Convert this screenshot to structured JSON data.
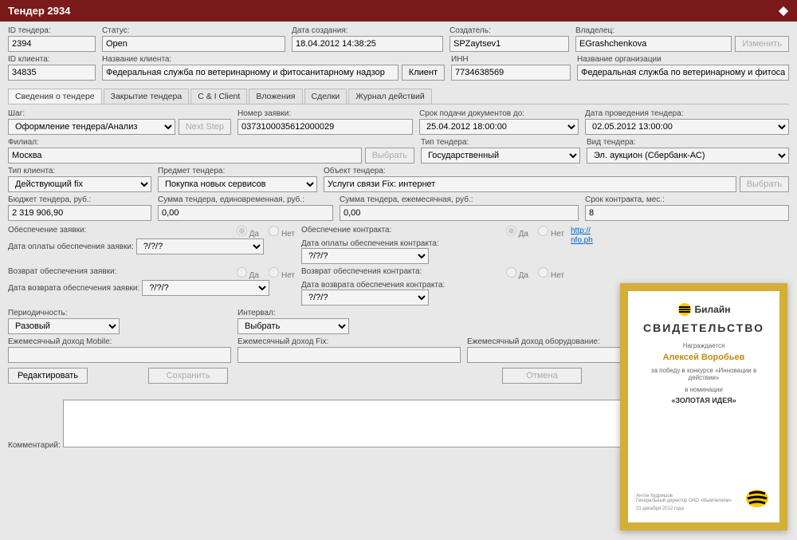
{
  "title": "Тендер 2934",
  "header": {
    "id_tender": {
      "label": "ID тендера:",
      "value": "2394"
    },
    "status": {
      "label": "Статус:",
      "value": "Open"
    },
    "created": {
      "label": "Дата создания:",
      "value": "18.04.2012 14:38:25"
    },
    "creator": {
      "label": "Создатель:",
      "value": "SPZaytsev1"
    },
    "owner": {
      "label": "Владелец:",
      "value": "EGrashchenkova",
      "change_btn": "Изменить"
    },
    "id_client": {
      "label": "ID клиента:",
      "value": "34835"
    },
    "client_name": {
      "label": "Название клиента:",
      "value": "Федеральная служба по ветеринарному и фитосанитарному надзор",
      "btn": "Клиент"
    },
    "inn": {
      "label": "ИНН",
      "value": "7734638569"
    },
    "org_name": {
      "label": "Название организации",
      "value": "Федеральная служба по ветеринарному и фитосан"
    }
  },
  "tabs": [
    "Сведения о тендере",
    "Закрытие тендера",
    "C & I Client",
    "Вложения",
    "Сделки",
    "Журнал действий"
  ],
  "form": {
    "step": {
      "label": "Шаг:",
      "value": "Оформление тендера/Анализ",
      "next_btn": "Next Step"
    },
    "app_num": {
      "label": "Номер заявки:",
      "value": "0373100035612000029"
    },
    "doc_deadline": {
      "label": "Срок подачи документов до:",
      "value": "25.04.2012 18:00:00"
    },
    "tender_date": {
      "label": "Дата проведения тендера:",
      "value": "02.05.2012 13:00:00"
    },
    "branch": {
      "label": "Филиал:",
      "value": "Москва",
      "btn": "Выбрать"
    },
    "tender_type": {
      "label": "Тип тендера:",
      "value": "Государственный"
    },
    "tender_kind": {
      "label": "Вид тендера:",
      "value": "Эл. аукцион (Сбербанк-АС)"
    },
    "client_type": {
      "label": "Тип клиента:",
      "value": "Действующий fix"
    },
    "subject": {
      "label": "Предмет тендера:",
      "value": "Покупка новых сервисов"
    },
    "object": {
      "label": "Объект тендера:",
      "value": "Услуги связи Fix: интернет",
      "btn": "Выбрать"
    },
    "budget": {
      "label": "Бюджет тендера, руб.:",
      "value": "2 319 906,90"
    },
    "sum_once": {
      "label": "Сумма тендера, единовременная, руб.:",
      "value": "0,00"
    },
    "sum_monthly": {
      "label": "Сумма тендера, ежемесячная, руб.:",
      "value": "0,00"
    },
    "contract_term": {
      "label": "Срок контракта, мес.:",
      "value": "8"
    },
    "sec_app": {
      "label": "Обеспечение заявки:",
      "yes": "Да",
      "no": "Нет"
    },
    "sec_app_date": {
      "label": "Дата оплаты обеспечения заявки:",
      "value": "?/?/?"
    },
    "sec_contract": {
      "label": "Обеспечение контракта:",
      "yes": "Да",
      "no": "Нет"
    },
    "sec_contract_date": {
      "label": "Дата оплаты обеспечения контракта:",
      "value": "?/?/?"
    },
    "ret_app": {
      "label": "Возврат обеспечения заявки:",
      "yes": "Да",
      "no": "Нет"
    },
    "ret_app_date": {
      "label": "Дата возврата обеспечения заявки:",
      "value": "?/?/?"
    },
    "ret_contract": {
      "label": "Возврат обеспечения контракта:",
      "yes": "Да",
      "no": "Нет"
    },
    "ret_contract_date": {
      "label": "Дата возврата обеспечения контракта:",
      "value": "?/?/?"
    },
    "periodicity": {
      "label": "Периодичность:",
      "value": "Разовый"
    },
    "interval": {
      "label": "Интервал:",
      "value": "Выбрать"
    },
    "rev_mobile": {
      "label": "Ежемесячный доход Mobile:",
      "value": ""
    },
    "rev_fix": {
      "label": "Ежемесячный доход Fix:",
      "value": ""
    },
    "rev_equip": {
      "label": "Ежемесячный доход оборудование:",
      "value": ""
    },
    "edit_btn": "Редактировать",
    "save_btn": "Сохранить",
    "cancel_btn": "Отмена",
    "link": {
      "text1": "http://",
      "text2": "nfo.ph"
    },
    "comment": {
      "label": "Комментарий:"
    }
  },
  "cert": {
    "brand": "Билайн",
    "title": "СВИДЕТЕЛЬСТВО",
    "awarded": "Награждается",
    "name": "Алексей Воробьев",
    "for": "за победу в конкурсе «Инновации в действии»",
    "in_nom": "в номинации",
    "nom": "«ЗОЛОТАЯ ИДЕЯ»",
    "signer": "Антон Кудряшов\nГенеральный директор ОАО «Вымпелком»",
    "date": "21 декабря 2012 года"
  }
}
